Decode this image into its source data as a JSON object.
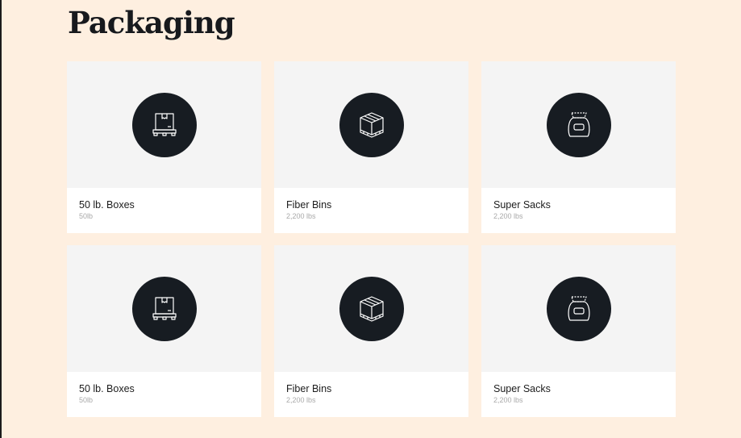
{
  "page": {
    "title": "Packaging"
  },
  "colors": {
    "background": "#FEEFE0",
    "card_media": "#F4F4F4",
    "icon_circle": "#171C22",
    "text": "#1c1c1c",
    "muted_text": "#a9a9a9"
  },
  "products": [
    {
      "name": "50 lb. Boxes",
      "weight": "50lb",
      "icon": "box-on-pallet-icon"
    },
    {
      "name": "Fiber Bins",
      "weight": "2,200 lbs",
      "icon": "fiber-bin-icon"
    },
    {
      "name": "Super Sacks",
      "weight": "2,200 lbs",
      "icon": "super-sack-icon"
    },
    {
      "name": "50 lb. Boxes",
      "weight": "50lb",
      "icon": "box-on-pallet-icon"
    },
    {
      "name": "Fiber Bins",
      "weight": "2,200 lbs",
      "icon": "fiber-bin-icon"
    },
    {
      "name": "Super Sacks",
      "weight": "2,200 lbs",
      "icon": "super-sack-icon"
    }
  ]
}
